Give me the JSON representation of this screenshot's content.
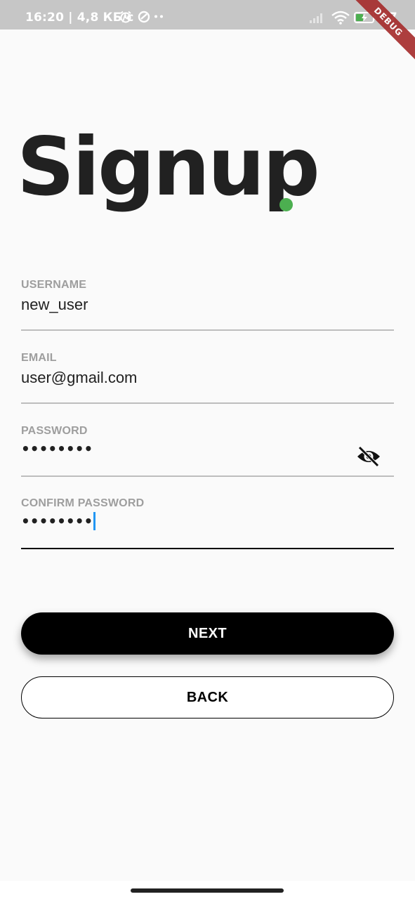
{
  "status_bar": {
    "time_and_speed": "16:20 | 4,8 КБ/с",
    "battery_level": "37",
    "icons": [
      "alarm-icon",
      "data-saver-icon",
      "more-dots-icon",
      "signal-icon",
      "wifi-icon",
      "battery-charging-icon"
    ]
  },
  "debug_banner": "DEBUG",
  "title": "Signup",
  "accent_color": "#4caf50",
  "fields": {
    "username": {
      "label": "USERNAME",
      "value": "new_user"
    },
    "email": {
      "label": "EMAIL",
      "value": "user@gmail.com"
    },
    "password": {
      "label": "PASSWORD",
      "value": "••••••••",
      "toggle_icon": "eye-off-icon"
    },
    "confirm_password": {
      "label": "CONFIRM PASSWORD",
      "value": "••••••••"
    }
  },
  "buttons": {
    "next": "NEXT",
    "back": "BACK"
  }
}
